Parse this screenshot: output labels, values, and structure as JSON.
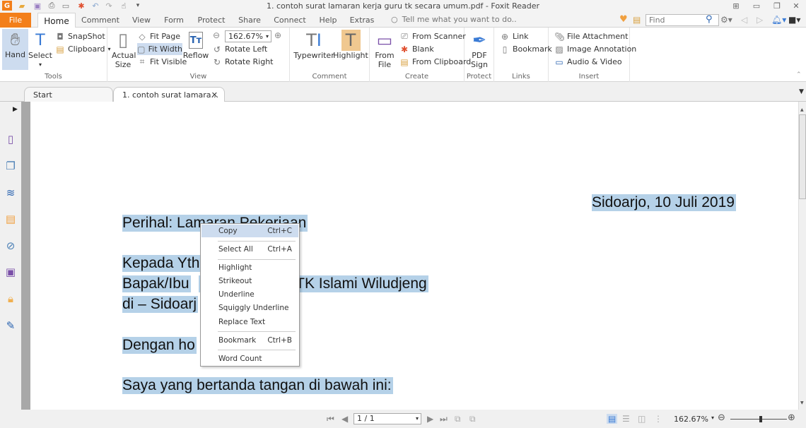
{
  "window": {
    "title": "1. contoh surat lamaran kerja guru tk secara umum.pdf - Foxit Reader",
    "quick_access": [
      "foxit-logo-icon",
      "open-icon",
      "save-icon",
      "print-icon",
      "email-icon",
      "new-icon",
      "undo-icon",
      "redo-icon",
      "hand-tool-icon",
      "customize-icon"
    ],
    "controls": [
      "restore-layout-icon",
      "minimize-icon",
      "maximize-icon",
      "close-icon"
    ]
  },
  "ribbon_tabs": [
    "File",
    "Home",
    "Comment",
    "View",
    "Form",
    "Protect",
    "Share",
    "Connect",
    "Help",
    "Extras"
  ],
  "active_tab": "Home",
  "tell_me": "Tell me what you want to do..",
  "find_placeholder": "Find",
  "ribbon": {
    "tools": {
      "label": "Tools",
      "hand": "Hand",
      "select": "Select",
      "snapshot": "SnapShot",
      "clipboard": "Clipboard"
    },
    "view": {
      "label": "View",
      "actual_size": "Actual Size",
      "fit_page": "Fit Page",
      "fit_width": "Fit Width",
      "fit_visible": "Fit Visible",
      "reflow": "Reflow",
      "zoom_value": "162.67%",
      "rotate_left": "Rotate Left",
      "rotate_right": "Rotate Right"
    },
    "comment": {
      "label": "Comment",
      "typewriter": "Typewriter",
      "highlight": "Highlight"
    },
    "create": {
      "label": "Create",
      "from_file": "From File",
      "from_scanner": "From Scanner",
      "blank": "Blank",
      "from_clipboard": "From Clipboard"
    },
    "protect": {
      "label": "Protect",
      "pdf_sign": "PDF Sign"
    },
    "links": {
      "label": "Links",
      "link": "Link",
      "bookmark": "Bookmark"
    },
    "insert": {
      "label": "Insert",
      "file_attachment": "File Attachment",
      "image_annotation": "Image Annotation",
      "audio_video": "Audio & Video"
    }
  },
  "doc_tabs": [
    {
      "label": "Start"
    },
    {
      "label": "1. contoh surat lamara...",
      "active": true
    }
  ],
  "document": {
    "date": "Sidoarjo, 10 Juli 2019",
    "perihal": "Perihal: Lamaran Pekerjaan",
    "kepada": "Kepada Yth",
    "bapak": "Bapak/Ibu",
    "bapak_rest": "h TK Islami Wiludjeng",
    "di": "di – Sidoarj",
    "dengan": "Dengan ho",
    "saya": "Saya yang bertanda tangan di bawah ini:"
  },
  "context_menu": [
    {
      "label": "Copy",
      "shortcut": "Ctrl+C",
      "highlighted": true
    },
    {
      "label": "Select All",
      "shortcut": "Ctrl+A"
    },
    {
      "label": "Highlight"
    },
    {
      "label": "Strikeout"
    },
    {
      "label": "Underline"
    },
    {
      "label": "Squiggly Underline"
    },
    {
      "label": "Replace Text"
    },
    {
      "label": "Bookmark",
      "shortcut": "Ctrl+B"
    },
    {
      "label": "Word Count"
    }
  ],
  "status": {
    "page": "1 / 1",
    "zoom": "162.67%"
  },
  "colors": {
    "accent": "#f37f1a",
    "selection": "#b5d1e8",
    "menu_highlight": "#cddcef"
  }
}
